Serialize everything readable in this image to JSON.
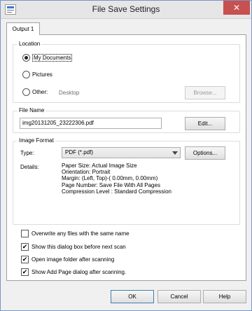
{
  "window": {
    "title": "File Save Settings"
  },
  "tabs": [
    {
      "label": "Output 1"
    }
  ],
  "location": {
    "group_title": "Location",
    "options": [
      {
        "label": "My Documents",
        "selected": true
      },
      {
        "label": "Pictures",
        "selected": false
      },
      {
        "label": "Other:",
        "selected": false
      }
    ],
    "other_path": "Desktop",
    "browse_label": "Browse..."
  },
  "file_name": {
    "group_title": "File Name",
    "value": "img20131205_23222306.pdf",
    "edit_label": "Edit..."
  },
  "image_format": {
    "group_title": "Image Format",
    "type_label": "Type:",
    "type_value": "PDF (*.pdf)",
    "options_label": "Options...",
    "details_label": "Details:",
    "details": [
      "Paper Size: Actual Image Size",
      "Orientation: Portrait",
      "Margin: (Left, Top)-( 0.00mm, 0.00mm)",
      "Page Number: Save File With All Pages",
      "Compression Level : Standard Compression"
    ]
  },
  "checkboxes": [
    {
      "label": "Overwrite any files with the same name",
      "checked": false
    },
    {
      "label": "Show this dialog box before next scan",
      "checked": true
    },
    {
      "label": "Open image folder after scanning",
      "checked": true
    },
    {
      "label": "Show Add Page dialog after scanning.",
      "checked": true
    }
  ],
  "footer": {
    "ok": "OK",
    "cancel": "Cancel",
    "help": "Help"
  }
}
